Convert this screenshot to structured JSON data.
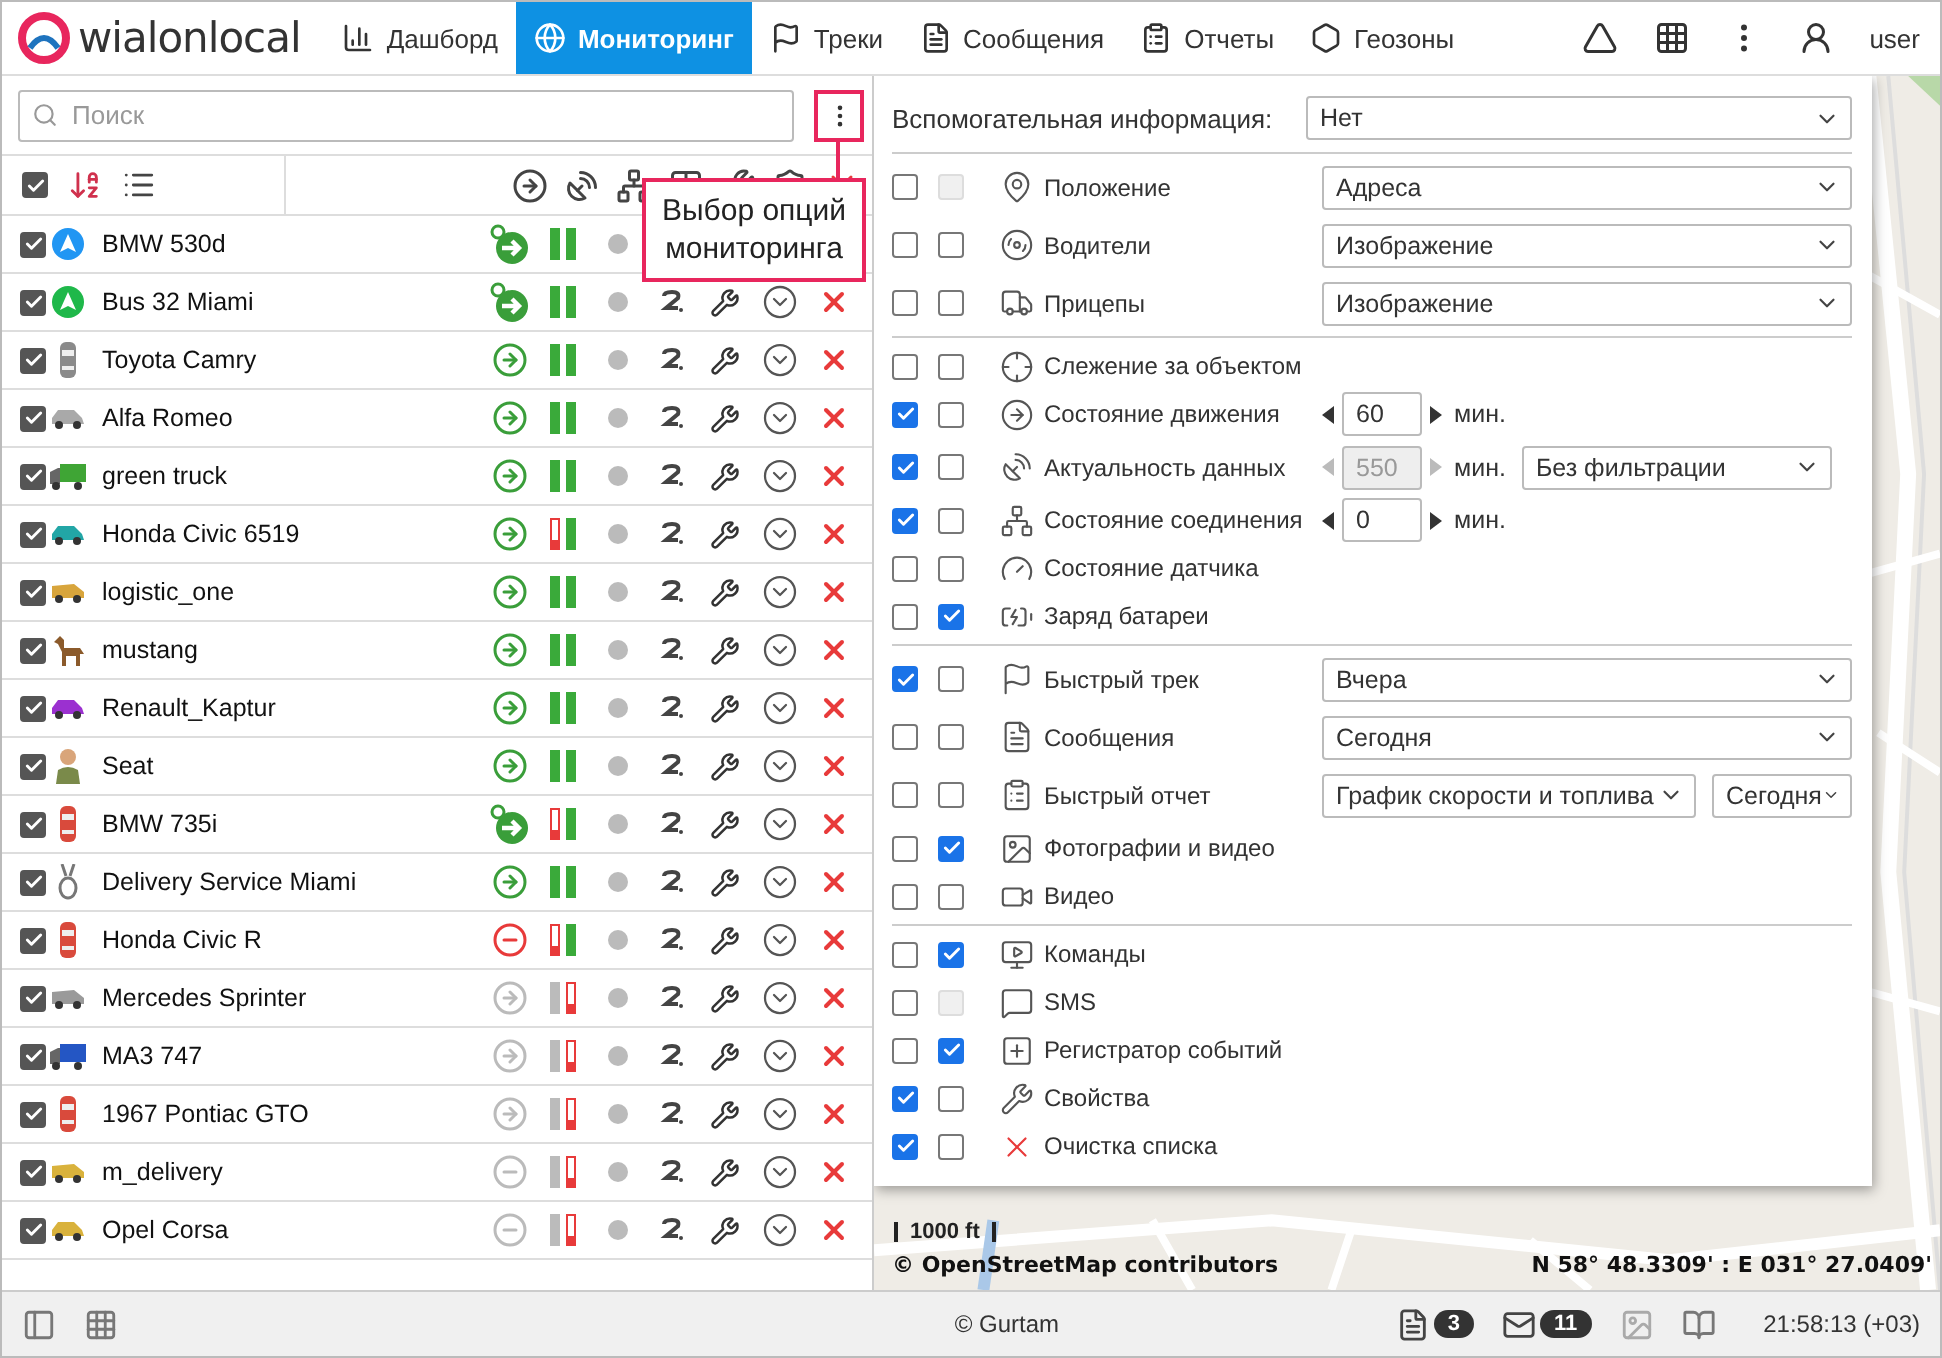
{
  "nav": {
    "logo": "wialonlocal",
    "items": [
      {
        "label": "Дашборд",
        "selected": false
      },
      {
        "label": "Мониторинг",
        "selected": true
      },
      {
        "label": "Треки",
        "selected": false
      },
      {
        "label": "Сообщения",
        "selected": false
      },
      {
        "label": "Отчеты",
        "selected": false
      },
      {
        "label": "Геозоны",
        "selected": false
      }
    ],
    "user": "user"
  },
  "search": {
    "placeholder": "Поиск"
  },
  "list_header": {
    "checked": true
  },
  "tooltip": "Выбор опций мониторинга",
  "units": [
    {
      "name": "BMW 530d",
      "checked": true,
      "color": "#2196f3",
      "moving": true,
      "ignition": true,
      "outdated": false,
      "alert": false
    },
    {
      "name": "Bus 32 Miami",
      "checked": true,
      "color": "#1fb84a",
      "moving": true,
      "ignition": true,
      "outdated": false,
      "alert": false
    },
    {
      "name": "Toyota Camry",
      "checked": true,
      "color": "#8a8a8a",
      "moving": true,
      "ignition": false,
      "outdated": false,
      "alert": false
    },
    {
      "name": "Alfa Romeo",
      "checked": true,
      "color": "#a9a9a9",
      "moving": true,
      "ignition": false,
      "outdated": false,
      "alert": false
    },
    {
      "name": "green truck",
      "checked": true,
      "color": "#3fa535",
      "moving": true,
      "ignition": false,
      "outdated": false,
      "alert": false
    },
    {
      "name": "Honda Civic 6519",
      "checked": true,
      "color": "#22a6a6",
      "moving": true,
      "ignition": false,
      "outdated": false,
      "alert": true
    },
    {
      "name": "logistic_one",
      "checked": true,
      "color": "#d8a53c",
      "moving": true,
      "ignition": false,
      "outdated": false,
      "alert": false
    },
    {
      "name": "mustang",
      "checked": true,
      "color": "#8b5a2b",
      "moving": true,
      "ignition": false,
      "outdated": false,
      "alert": false
    },
    {
      "name": "Renault_Kaptur",
      "checked": true,
      "color": "#9b30d0",
      "moving": true,
      "ignition": false,
      "outdated": false,
      "alert": false
    },
    {
      "name": "Seat",
      "checked": true,
      "color": "#7a8a4a",
      "moving": true,
      "ignition": false,
      "outdated": false,
      "alert": false
    },
    {
      "name": "BMW 735i",
      "checked": true,
      "color": "#d94a3c",
      "moving": true,
      "ignition": true,
      "outdated": false,
      "alert": true
    },
    {
      "name": "Delivery Service Miami",
      "checked": true,
      "color": "#777777",
      "moving": true,
      "ignition": false,
      "outdated": false,
      "alert": false
    },
    {
      "name": "Honda Civic R",
      "checked": true,
      "color": "#d94a3c",
      "moving": false,
      "ignition": false,
      "outdated": false,
      "alert": true
    },
    {
      "name": "Mercedes Sprinter",
      "checked": true,
      "color": "#9a9a9a",
      "moving": true,
      "ignition": false,
      "outdated": true,
      "alert": false
    },
    {
      "name": "MA3 747",
      "checked": true,
      "color": "#2456c4",
      "moving": true,
      "ignition": false,
      "outdated": true,
      "alert": false
    },
    {
      "name": "1967 Pontiac GTO",
      "checked": true,
      "color": "#d94a3c",
      "moving": true,
      "ignition": false,
      "outdated": true,
      "alert": false
    },
    {
      "name": "m_delivery",
      "checked": true,
      "color": "#d9b23c",
      "moving": false,
      "ignition": false,
      "outdated": true,
      "alert": false
    },
    {
      "name": "Opel Corsa",
      "checked": true,
      "color": "#d9b23c",
      "moving": false,
      "ignition": false,
      "outdated": true,
      "alert": false
    }
  ],
  "options": {
    "aux_label": "Вспомогательная информация:",
    "aux_value": "Нет",
    "groups": [
      [
        {
          "label": "Положение",
          "checks": [
            {
              "checked": false,
              "disabled": false
            },
            {
              "checked": false,
              "disabled": true
            }
          ],
          "controls": [
            {
              "kind": "select",
              "value": "Адреса"
            }
          ]
        },
        {
          "label": "Водители",
          "checks": [
            {
              "checked": false,
              "disabled": false
            },
            {
              "checked": false,
              "disabled": false
            }
          ],
          "controls": [
            {
              "kind": "select",
              "value": "Изображение"
            }
          ]
        },
        {
          "label": "Прицепы",
          "checks": [
            {
              "checked": false,
              "disabled": false
            },
            {
              "checked": false,
              "disabled": false
            }
          ],
          "controls": [
            {
              "kind": "select",
              "value": "Изображение"
            }
          ]
        }
      ],
      [
        {
          "label": "Слежение за объектом",
          "checks": [
            {
              "checked": false,
              "disabled": false
            },
            {
              "checked": false,
              "disabled": false
            }
          ]
        },
        {
          "label": "Состояние движения",
          "checks": [
            {
              "checked": true,
              "disabled": false
            },
            {
              "checked": false,
              "disabled": false
            }
          ],
          "controls": [
            {
              "kind": "spinner",
              "value": "60",
              "unit": "мин.",
              "disabled": false
            }
          ]
        },
        {
          "label": "Актуальность данных",
          "checks": [
            {
              "checked": true,
              "disabled": false
            },
            {
              "checked": false,
              "disabled": false
            }
          ],
          "controls": [
            {
              "kind": "spinner",
              "value": "550",
              "unit": "мин.",
              "disabled": true
            },
            {
              "kind": "select",
              "value": "Без фильтрации"
            }
          ]
        },
        {
          "label": "Состояние соединения",
          "checks": [
            {
              "checked": true,
              "disabled": false
            },
            {
              "checked": false,
              "disabled": false
            }
          ],
          "controls": [
            {
              "kind": "spinner",
              "value": "0",
              "unit": "мин.",
              "disabled": false
            }
          ]
        },
        {
          "label": "Состояние датчика",
          "checks": [
            {
              "checked": false,
              "disabled": false
            },
            {
              "checked": false,
              "disabled": false
            }
          ]
        },
        {
          "label": "Заряд батареи",
          "checks": [
            {
              "checked": false,
              "disabled": false
            },
            {
              "checked": true,
              "disabled": false
            }
          ]
        }
      ],
      [
        {
          "label": "Быстрый трек",
          "checks": [
            {
              "checked": true,
              "disabled": false
            },
            {
              "checked": false,
              "disabled": false
            }
          ],
          "controls": [
            {
              "kind": "select",
              "value": "Вчера"
            }
          ]
        },
        {
          "label": "Сообщения",
          "checks": [
            {
              "checked": false,
              "disabled": false
            },
            {
              "checked": false,
              "disabled": false
            }
          ],
          "controls": [
            {
              "kind": "select",
              "value": "Сегодня"
            }
          ]
        },
        {
          "label": "Быстрый отчет",
          "checks": [
            {
              "checked": false,
              "disabled": false
            },
            {
              "checked": false,
              "disabled": false
            }
          ],
          "controls": [
            {
              "kind": "select",
              "value": "График скорости и топлива"
            },
            {
              "kind": "select",
              "value": "Сегодня"
            }
          ]
        },
        {
          "label": "Фотографии и видео",
          "checks": [
            {
              "checked": false,
              "disabled": false
            },
            {
              "checked": true,
              "disabled": false
            }
          ]
        },
        {
          "label": "Видео",
          "checks": [
            {
              "checked": false,
              "disabled": false
            },
            {
              "checked": false,
              "disabled": false
            }
          ]
        }
      ],
      [
        {
          "label": "Команды",
          "checks": [
            {
              "checked": false,
              "disabled": false
            },
            {
              "checked": true,
              "disabled": false
            }
          ]
        },
        {
          "label": "SMS",
          "checks": [
            {
              "checked": false,
              "disabled": false
            },
            {
              "checked": false,
              "disabled": true
            }
          ]
        },
        {
          "label": "Регистратор событий",
          "checks": [
            {
              "checked": false,
              "disabled": false
            },
            {
              "checked": true,
              "disabled": false
            }
          ]
        },
        {
          "label": "Свойства",
          "checks": [
            {
              "checked": true,
              "disabled": false
            },
            {
              "checked": false,
              "disabled": false
            }
          ]
        },
        {
          "label": "Очистка списка",
          "checks": [
            {
              "checked": true,
              "disabled": false
            },
            {
              "checked": false,
              "disabled": false
            }
          ]
        }
      ]
    ]
  },
  "map": {
    "scale": "1000 ft",
    "attribution": "© OpenStreetMap contributors",
    "coords": "N 58° 48.3309' : E 031° 27.0409'"
  },
  "footer": {
    "copyright": "© Gurtam",
    "messages_count": "3",
    "mail_count": "11",
    "time": "21:58:13 (+03)"
  }
}
